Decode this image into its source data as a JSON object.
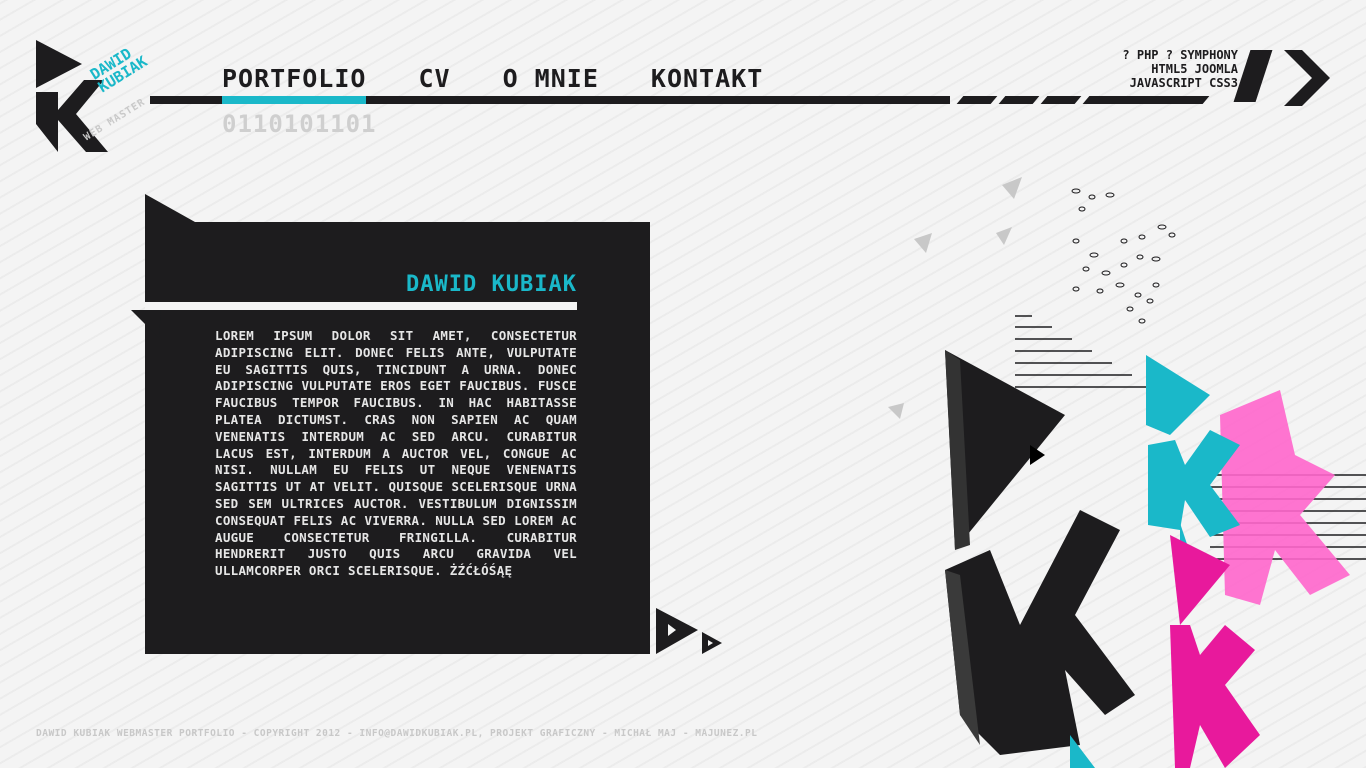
{
  "logo": {
    "line1": "DAWID",
    "line2": "KUBIAK",
    "subtitle": "WEB MASTER"
  },
  "nav": {
    "items": [
      {
        "label": "PORTFOLIO",
        "active": true
      },
      {
        "label": "CV",
        "active": false
      },
      {
        "label": "O MNIE",
        "active": false
      },
      {
        "label": "KONTAKT",
        "active": false
      }
    ],
    "binary": "0110101101"
  },
  "skills": {
    "line1": "? PHP ? SYMPHONY",
    "line2": "HTML5 JOOMLA",
    "line3": "JAVASCRIPT CSS3"
  },
  "content": {
    "title": "DAWID KUBIAK",
    "body": "LOREM IPSUM DOLOR SIT AMET, CONSECTETUR ADIPISCING ELIT. DONEC FELIS ANTE, VULPUTATE EU SAGITTIS QUIS, TINCIDUNT A URNA. DONEC ADIPISCING VULPUTATE EROS EGET FAUCIBUS. FUSCE FAUCIBUS TEMPOR FAUCIBUS. IN HAC HABITASSE PLATEA DICTUMST. CRAS NON SAPIEN AC QUAM VENENATIS INTERDUM AC SED ARCU. CURABITUR LACUS EST, INTERDUM A AUCTOR VEL, CONGUE AC NISI. NULLAM EU FELIS UT NEQUE VENENATIS SAGITTIS UT AT VELIT. QUISQUE SCELERISQUE URNA SED SEM ULTRICES AUCTOR. VESTIBULUM DIGNISSIM CONSEQUAT FELIS AC VIVERRA. NULLA SED LOREM AC AUGUE CONSECTETUR FRINGILLA. CURABITUR HENDRERIT JUSTO QUIS ARCU GRAVIDA VEL ULLAMCORPER ORCI SCELERISQUE. ŻŹĆŁÓŚĄĘ"
  },
  "footer": {
    "text": "DAWID KUBIAK WEBMASTER PORTFOLIO - COPYRIGHT 2012 - INFO@DAWIDKUBIAK.PL, PROJEKT GRAFICZNY - MICHAŁ MAJ - MAJUNEZ.PL"
  },
  "colors": {
    "accent": "#1ab8c9",
    "dark": "#1d1c1e",
    "pink": "#e8199c",
    "background": "#f4f4f4"
  }
}
